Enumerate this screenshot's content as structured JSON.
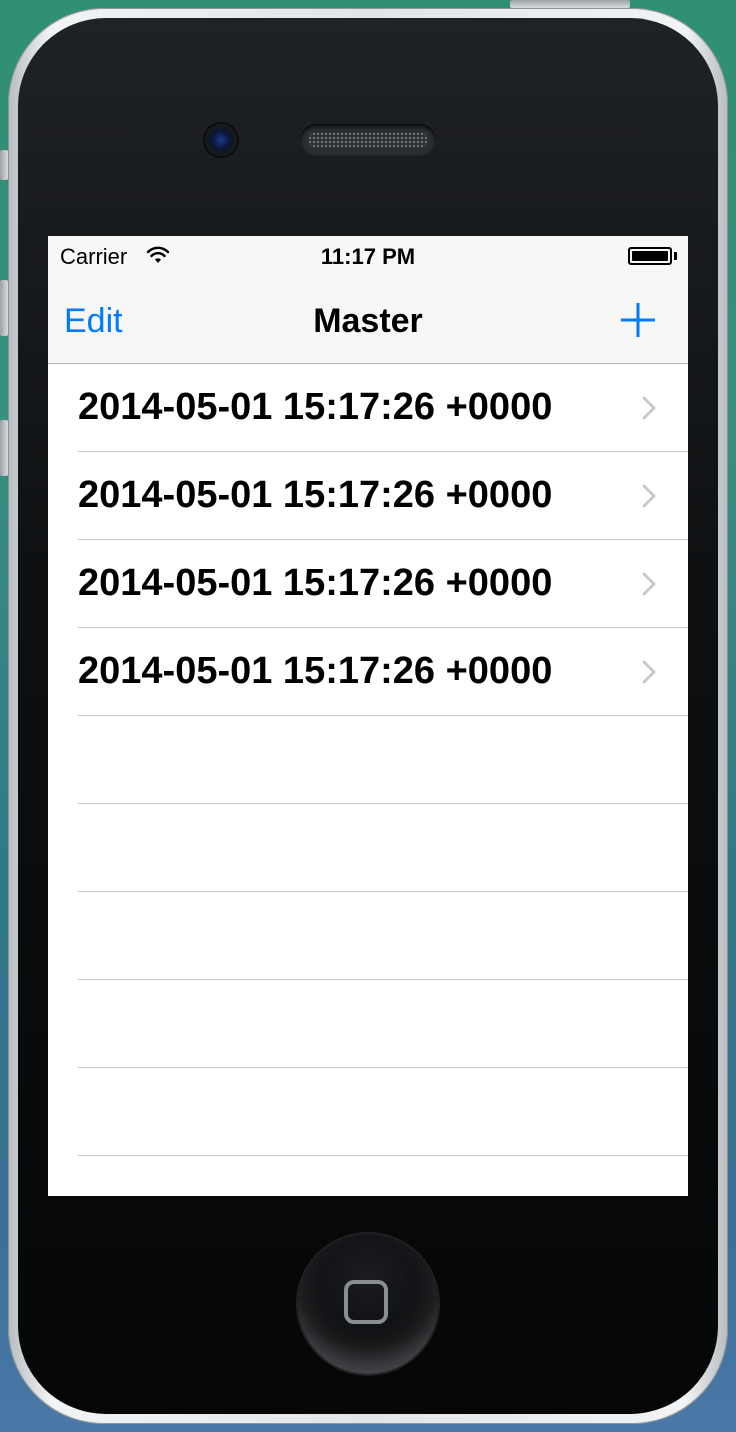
{
  "status_bar": {
    "carrier": "Carrier",
    "time": "11:17 PM",
    "battery_level": 1.0
  },
  "nav_bar": {
    "edit_label": "Edit",
    "title": "Master",
    "add_icon": "plus-icon"
  },
  "rows": [
    {
      "label": "2014-05-01 15:17:26 +0000"
    },
    {
      "label": "2014-05-01 15:17:26 +0000"
    },
    {
      "label": "2014-05-01 15:17:26 +0000"
    },
    {
      "label": "2014-05-01 15:17:26 +0000"
    }
  ],
  "colors": {
    "tint": "#007aff",
    "separator": "#c8c7cc",
    "chevron": "#c7c7cc",
    "bar_background": "#f7f7f7"
  }
}
